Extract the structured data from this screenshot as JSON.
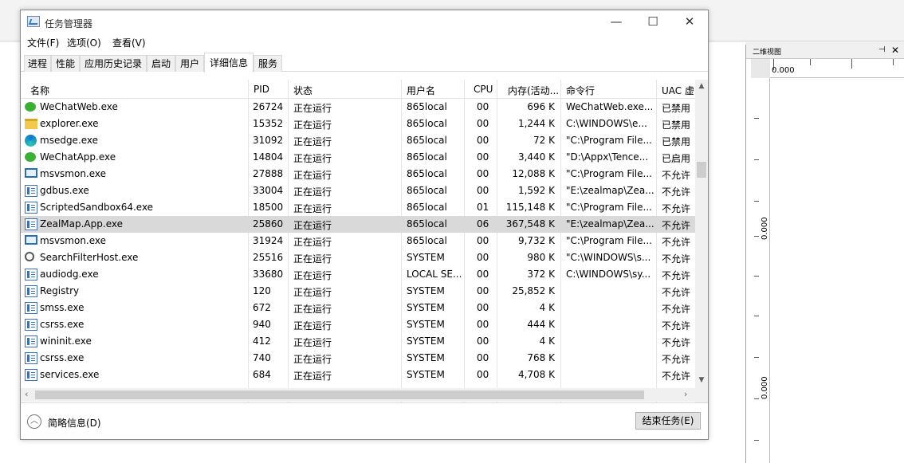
{
  "window": {
    "title": "任务管理器"
  },
  "menu": [
    "文件(F)",
    "选项(O)",
    "查看(V)"
  ],
  "tabs": [
    "进程",
    "性能",
    "应用历史记录",
    "启动",
    "用户",
    "详细信息",
    "服务"
  ],
  "active_tab": "详细信息",
  "columns": [
    "名称",
    "PID",
    "状态",
    "用户名",
    "CPU",
    "内存(活动...",
    "命令行",
    "UAC 虚"
  ],
  "rows": [
    {
      "icon": "wechat-icon",
      "name": "WeChatWeb.exe",
      "pid": "26724",
      "status": "正在运行",
      "user": "865local",
      "cpu": "00",
      "mem": "696 K",
      "cmd": "WeChatWeb.exe...",
      "uac": "已禁用"
    },
    {
      "icon": "folder-icon",
      "name": "explorer.exe",
      "pid": "15352",
      "status": "正在运行",
      "user": "865local",
      "cpu": "00",
      "mem": "1,244 K",
      "cmd": "C:\\WINDOWS\\e...",
      "uac": "已禁用"
    },
    {
      "icon": "edge-icon",
      "name": "msedge.exe",
      "pid": "31092",
      "status": "正在运行",
      "user": "865local",
      "cpu": "00",
      "mem": "72 K",
      "cmd": "\"C:\\Program File...",
      "uac": "已禁用"
    },
    {
      "icon": "wechat-icon",
      "name": "WeChatApp.exe",
      "pid": "14804",
      "status": "正在运行",
      "user": "865local",
      "cpu": "00",
      "mem": "3,440 K",
      "cmd": "\"D:\\Appx\\Tence...",
      "uac": "已启用"
    },
    {
      "icon": "monitor-icon",
      "name": "msvsmon.exe",
      "pid": "27888",
      "status": "正在运行",
      "user": "865local",
      "cpu": "00",
      "mem": "12,088 K",
      "cmd": "\"C:\\Program File...",
      "uac": "不允许"
    },
    {
      "icon": "app-icon",
      "name": "gdbus.exe",
      "pid": "33004",
      "status": "正在运行",
      "user": "865local",
      "cpu": "00",
      "mem": "1,592 K",
      "cmd": "\"E:\\zealmap\\Zea...",
      "uac": "不允许"
    },
    {
      "icon": "app-icon",
      "name": "ScriptedSandbox64.exe",
      "pid": "18500",
      "status": "正在运行",
      "user": "865local",
      "cpu": "01",
      "mem": "115,148 K",
      "cmd": "\"C:\\Program File...",
      "uac": "不允许"
    },
    {
      "icon": "app-icon",
      "name": "ZealMap.App.exe",
      "pid": "25860",
      "status": "正在运行",
      "user": "865local",
      "cpu": "06",
      "mem": "367,548 K",
      "cmd": "\"E:\\zealmap\\Zea...",
      "uac": "不允许",
      "selected": true
    },
    {
      "icon": "monitor-icon",
      "name": "msvsmon.exe",
      "pid": "31924",
      "status": "正在运行",
      "user": "865local",
      "cpu": "00",
      "mem": "9,732 K",
      "cmd": "\"C:\\Program File...",
      "uac": "不允许"
    },
    {
      "icon": "search-icon",
      "name": "SearchFilterHost.exe",
      "pid": "25516",
      "status": "正在运行",
      "user": "SYSTEM",
      "cpu": "00",
      "mem": "980 K",
      "cmd": "\"C:\\WINDOWS\\s...",
      "uac": "不允许"
    },
    {
      "icon": "app-icon",
      "name": "audiodg.exe",
      "pid": "33680",
      "status": "正在运行",
      "user": "LOCAL SE...",
      "cpu": "00",
      "mem": "372 K",
      "cmd": "C:\\WINDOWS\\sy...",
      "uac": "不允许"
    },
    {
      "icon": "app-icon",
      "name": "Registry",
      "pid": "120",
      "status": "正在运行",
      "user": "SYSTEM",
      "cpu": "00",
      "mem": "25,852 K",
      "cmd": "",
      "uac": "不允许"
    },
    {
      "icon": "app-icon",
      "name": "smss.exe",
      "pid": "672",
      "status": "正在运行",
      "user": "SYSTEM",
      "cpu": "00",
      "mem": "4 K",
      "cmd": "",
      "uac": "不允许"
    },
    {
      "icon": "app-icon",
      "name": "csrss.exe",
      "pid": "940",
      "status": "正在运行",
      "user": "SYSTEM",
      "cpu": "00",
      "mem": "444 K",
      "cmd": "",
      "uac": "不允许"
    },
    {
      "icon": "app-icon",
      "name": "wininit.exe",
      "pid": "412",
      "status": "正在运行",
      "user": "SYSTEM",
      "cpu": "00",
      "mem": "4 K",
      "cmd": "",
      "uac": "不允许"
    },
    {
      "icon": "app-icon",
      "name": "csrss.exe",
      "pid": "740",
      "status": "正在运行",
      "user": "SYSTEM",
      "cpu": "00",
      "mem": "768 K",
      "cmd": "",
      "uac": "不允许"
    },
    {
      "icon": "app-icon",
      "name": "services.exe",
      "pid": "684",
      "status": "正在运行",
      "user": "SYSTEM",
      "cpu": "00",
      "mem": "4,708 K",
      "cmd": "",
      "uac": "不允许"
    }
  ],
  "footer": {
    "summary_label": "简略信息(D)",
    "end_task_label": "结束任务(E)"
  },
  "side_panel": {
    "title": "二维视图",
    "ruler_x_label": "0.000",
    "ruler_y_labels": [
      "0.000",
      "0.000"
    ]
  }
}
